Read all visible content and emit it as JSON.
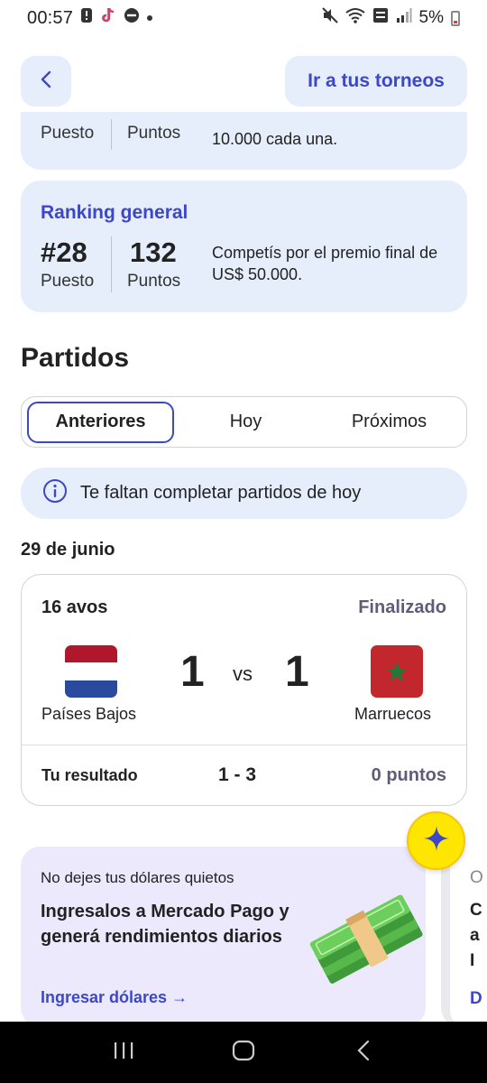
{
  "status_bar": {
    "time": "00:57",
    "battery": "5%"
  },
  "header": {
    "back_icon": "chevron-left-icon",
    "tournaments_button": "Ir a tus torneos"
  },
  "previous_ranking": {
    "puesto_label": "Puesto",
    "puntos_label": "Puntos",
    "description": "10.000 cada una."
  },
  "ranking_general": {
    "title": "Ranking general",
    "position": "#28",
    "position_label": "Puesto",
    "points": "132",
    "points_label": "Puntos",
    "description": "Competís por el premio final de US$ 50.000."
  },
  "partidos": {
    "title": "Partidos",
    "tabs": [
      {
        "label": "Anteriores",
        "active": true
      },
      {
        "label": "Hoy",
        "active": false
      },
      {
        "label": "Próximos",
        "active": false
      }
    ],
    "info_banner": "Te faltan completar partidos de hoy",
    "date": "29 de junio"
  },
  "match": {
    "round": "16 avos",
    "status": "Finalizado",
    "home_team": "Países Bajos",
    "home_score": "1",
    "vs": "vs",
    "away_team": "Marruecos",
    "away_score": "1",
    "result_label": "Tu resultado",
    "result_score": "1 - 3",
    "result_points": "0 puntos"
  },
  "promo": {
    "subtitle": "No dejes tus dólares quietos",
    "title": "Ingresalos a Mercado Pago y generá rendimientos diarios",
    "link": "Ingresar dólares →"
  },
  "colors": {
    "accent": "#3c48c8",
    "card_bg": "#e6edfb",
    "promo_bg": "#ebe9fb",
    "muted": "#5e5d78",
    "fab": "#ffe600"
  }
}
